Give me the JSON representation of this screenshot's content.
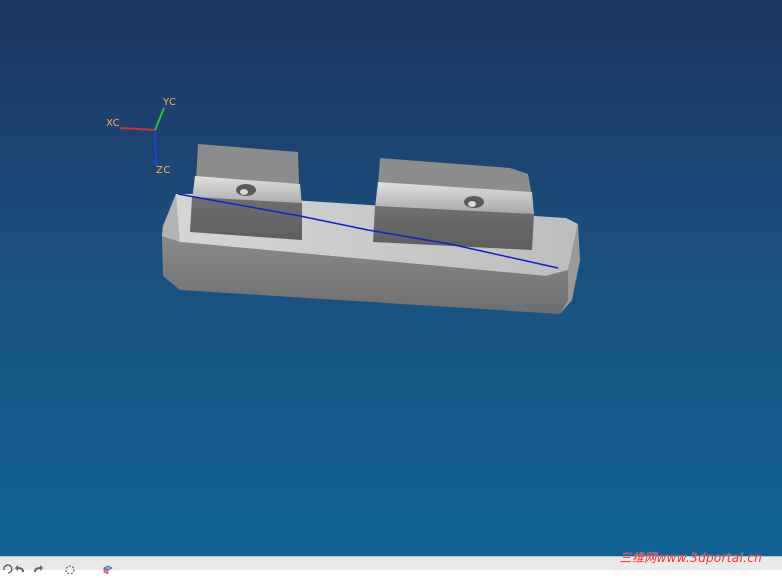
{
  "viewport": {
    "background_top": "#1f3462",
    "background_bottom": "#0f6394"
  },
  "axes": {
    "x_label": "XC",
    "y_label": "YC",
    "z_label": "ZC",
    "x_color": "#d03030",
    "y_color": "#30c030",
    "z_color": "#2040e0"
  },
  "model": {
    "body_color": "#7d7d7d",
    "face_light": "#c8c8c8",
    "edge_line_color": "#1020d0"
  },
  "toolbar": {
    "icons": [
      "rotate-icon",
      "undo-icon",
      "redo-icon",
      "circle-select-icon",
      "cube-view-icon"
    ]
  },
  "watermark": {
    "text": "三维网www.3dportal.cn"
  }
}
